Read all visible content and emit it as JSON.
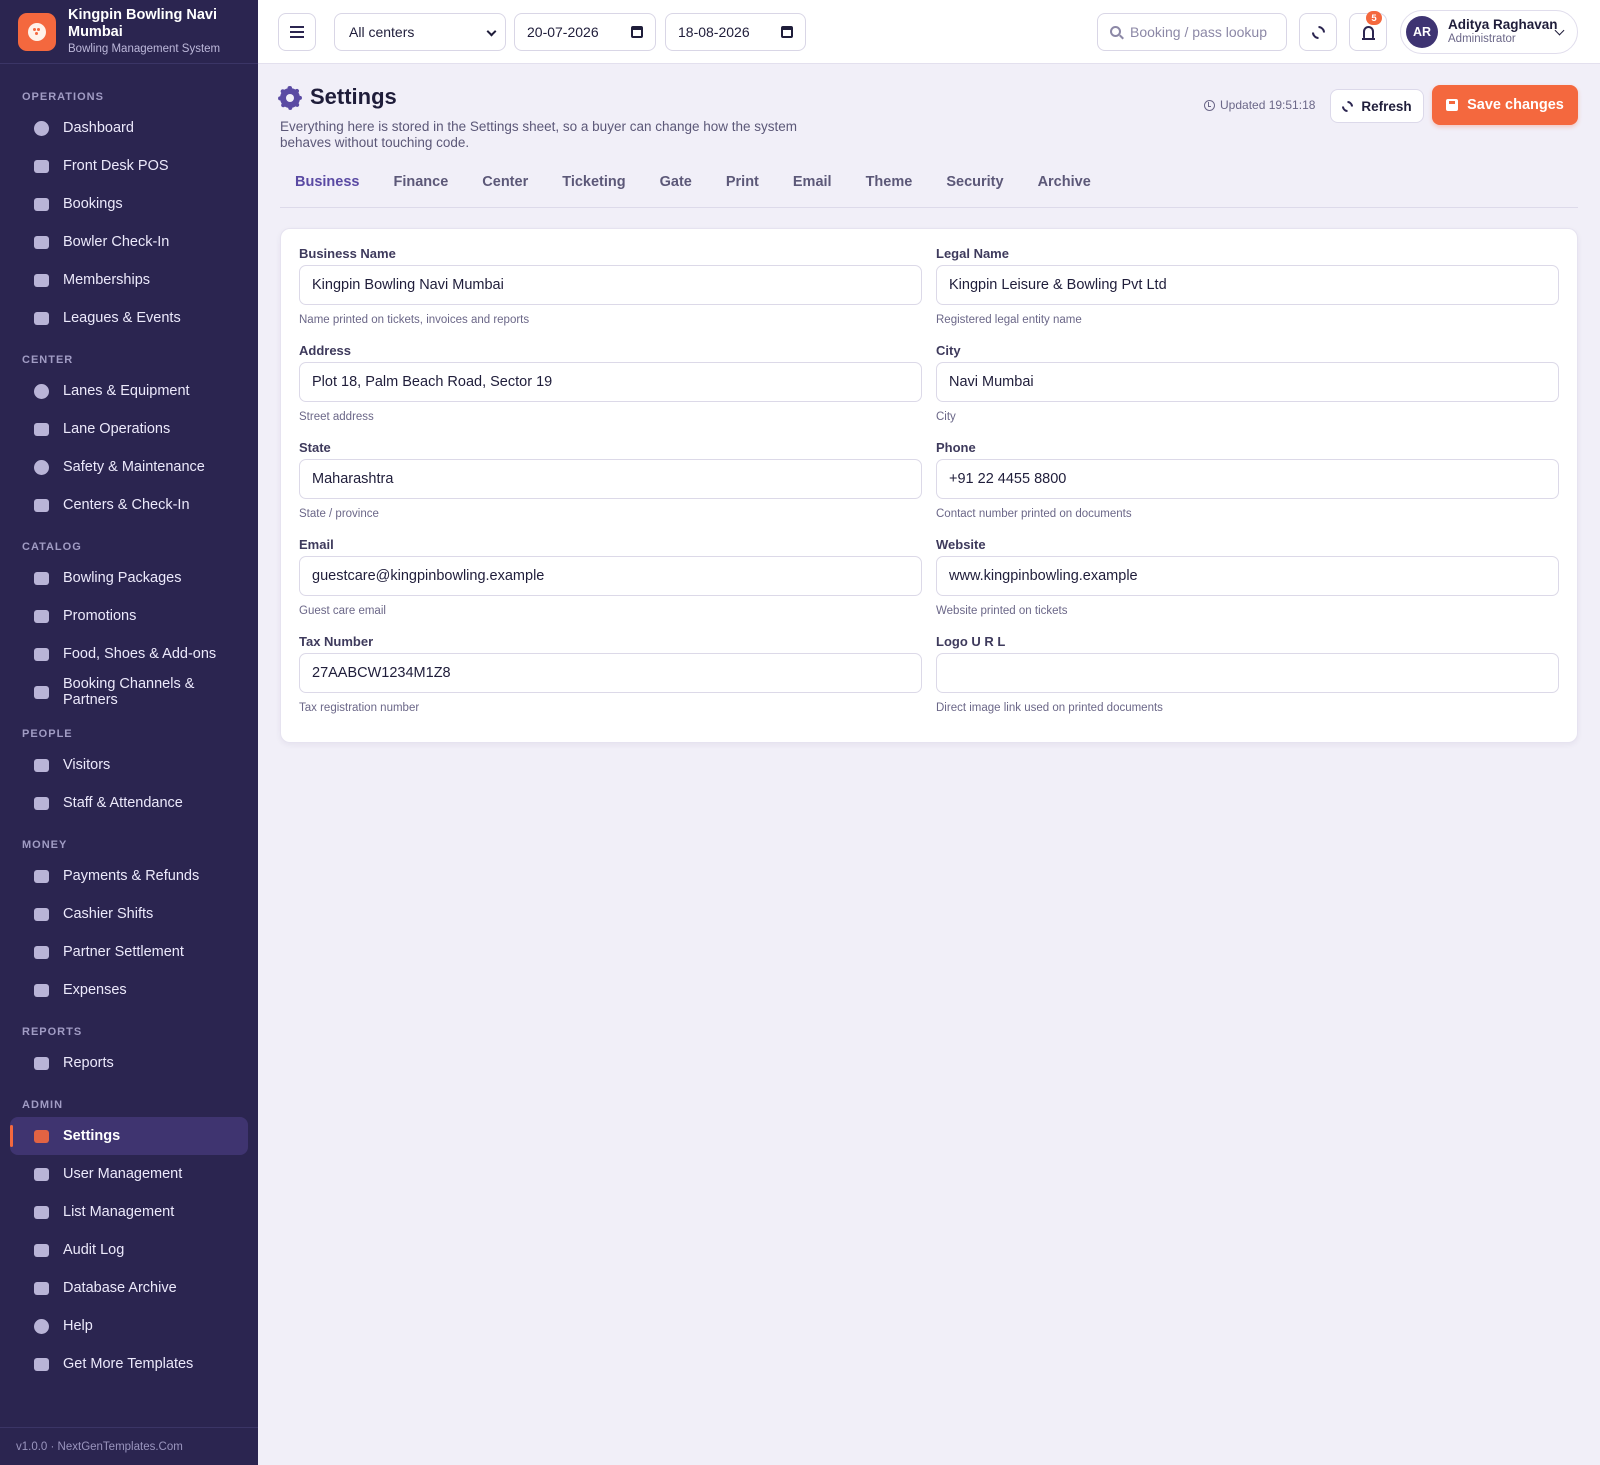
{
  "brand": {
    "name": "Kingpin Bowling Navi Mumbai",
    "subtitle": "Bowling Management System"
  },
  "sidebar": {
    "sections": [
      {
        "title": "OPERATIONS",
        "items": [
          {
            "label": "Dashboard",
            "icon": "dashboard-icon"
          },
          {
            "label": "Front Desk POS",
            "icon": "cash-register-icon"
          },
          {
            "label": "Bookings",
            "icon": "calendar-icon"
          },
          {
            "label": "Bowler Check-In",
            "icon": "check-in-icon"
          },
          {
            "label": "Memberships",
            "icon": "id-card-icon"
          },
          {
            "label": "Leagues & Events",
            "icon": "trophy-icon"
          }
        ]
      },
      {
        "title": "CENTER",
        "items": [
          {
            "label": "Lanes & Equipment",
            "icon": "bowling-ball-icon"
          },
          {
            "label": "Lane Operations",
            "icon": "cogs-icon"
          },
          {
            "label": "Safety & Maintenance",
            "icon": "shield-icon"
          },
          {
            "label": "Centers & Check-In",
            "icon": "building-icon"
          }
        ]
      },
      {
        "title": "CATALOG",
        "items": [
          {
            "label": "Bowling Packages",
            "icon": "package-icon"
          },
          {
            "label": "Promotions",
            "icon": "tags-icon"
          },
          {
            "label": "Food, Shoes & Add-ons",
            "icon": "basket-icon"
          },
          {
            "label": "Booking Channels & Partners",
            "icon": "broadcast-icon"
          }
        ]
      },
      {
        "title": "PEOPLE",
        "items": [
          {
            "label": "Visitors",
            "icon": "users-icon"
          },
          {
            "label": "Staff & Attendance",
            "icon": "staff-icon"
          }
        ]
      },
      {
        "title": "MONEY",
        "items": [
          {
            "label": "Payments & Refunds",
            "icon": "credit-card-icon"
          },
          {
            "label": "Cashier Shifts",
            "icon": "money-icon"
          },
          {
            "label": "Partner Settlement",
            "icon": "handshake-icon"
          },
          {
            "label": "Expenses",
            "icon": "wallet-icon"
          }
        ]
      },
      {
        "title": "REPORTS",
        "items": [
          {
            "label": "Reports",
            "icon": "bar-chart-icon"
          }
        ]
      },
      {
        "title": "ADMIN",
        "items": [
          {
            "label": "Settings",
            "icon": "gear-icon",
            "active": true
          },
          {
            "label": "User Management",
            "icon": "user-cog-icon"
          },
          {
            "label": "List Management",
            "icon": "list-icon"
          },
          {
            "label": "Audit Log",
            "icon": "clipboard-icon"
          },
          {
            "label": "Database Archive",
            "icon": "archive-icon"
          },
          {
            "label": "Help",
            "icon": "help-icon"
          },
          {
            "label": "Get More Templates",
            "icon": "star-icon"
          }
        ]
      }
    ],
    "footer": "v1.0.0 · NextGenTemplates.Com"
  },
  "topbar": {
    "center_select": "All centers",
    "date_from": "20-07-2026",
    "date_to": "18-08-2026",
    "search_placeholder": "Booking / pass lookup",
    "notification_count": "5",
    "user": {
      "initials": "AR",
      "name": "Aditya Raghavan",
      "role": "Administrator"
    }
  },
  "page": {
    "title": "Settings",
    "description": "Everything here is stored in the Settings sheet, so a buyer can change how the system behaves without touching code.",
    "updated": "Updated 19:51:18",
    "refresh_label": "Refresh",
    "save_label": "Save changes"
  },
  "tabs": [
    "Business",
    "Finance",
    "Center",
    "Ticketing",
    "Gate",
    "Print",
    "Email",
    "Theme",
    "Security",
    "Archive"
  ],
  "active_tab": "Business",
  "fields": [
    {
      "label": "Business Name",
      "value": "Kingpin Bowling Navi Mumbai",
      "help": "Name printed on tickets, invoices and reports"
    },
    {
      "label": "Legal Name",
      "value": "Kingpin Leisure & Bowling Pvt Ltd",
      "help": "Registered legal entity name"
    },
    {
      "label": "Address",
      "value": "Plot 18, Palm Beach Road, Sector 19",
      "help": "Street address"
    },
    {
      "label": "City",
      "value": "Navi Mumbai",
      "help": "City"
    },
    {
      "label": "State",
      "value": "Maharashtra",
      "help": "State / province"
    },
    {
      "label": "Phone",
      "value": "+91 22 4455 8800",
      "help": "Contact number printed on documents"
    },
    {
      "label": "Email",
      "value": "guestcare@kingpinbowling.example",
      "help": "Guest care email"
    },
    {
      "label": "Website",
      "value": "www.kingpinbowling.example",
      "help": "Website printed on tickets"
    },
    {
      "label": "Tax Number",
      "value": "27AABCW1234M1Z8",
      "help": "Tax registration number"
    },
    {
      "label": "Logo U R L",
      "value": "",
      "help": "Direct image link used on printed documents"
    }
  ],
  "colors": {
    "sidebar": "#2b2550",
    "accent": "#f4683e",
    "primary": "#5a4aa3"
  }
}
